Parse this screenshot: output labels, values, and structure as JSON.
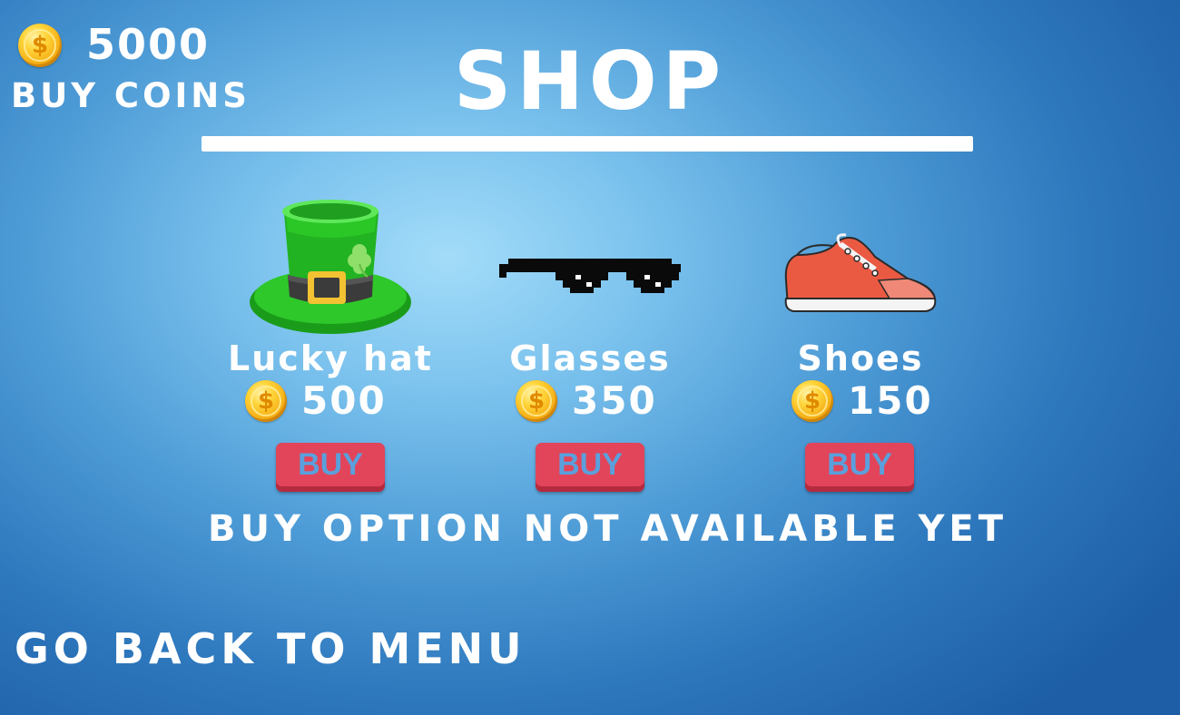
{
  "header": {
    "coin_icon": "coin-icon",
    "coin_balance": "5000",
    "buy_coins_label": "BUY COINS",
    "title": "SHOP"
  },
  "items": [
    {
      "name": "Lucky hat",
      "price": "500",
      "buy_label": "BUY",
      "icon": "leprechaun-hat-icon"
    },
    {
      "name": "Glasses",
      "price": "350",
      "buy_label": "BUY",
      "icon": "pixel-glasses-icon"
    },
    {
      "name": "Shoes",
      "price": "150",
      "buy_label": "BUY",
      "icon": "sneaker-icon"
    }
  ],
  "notice": "BUY OPTION NOT AVAILABLE YET",
  "back_to_menu_label": "GO BACK TO MENU",
  "colors": {
    "buy_button": "#e2445a",
    "buy_button_text": "#5aa0dc",
    "coin": "#f4a810",
    "text": "#ffffff"
  }
}
